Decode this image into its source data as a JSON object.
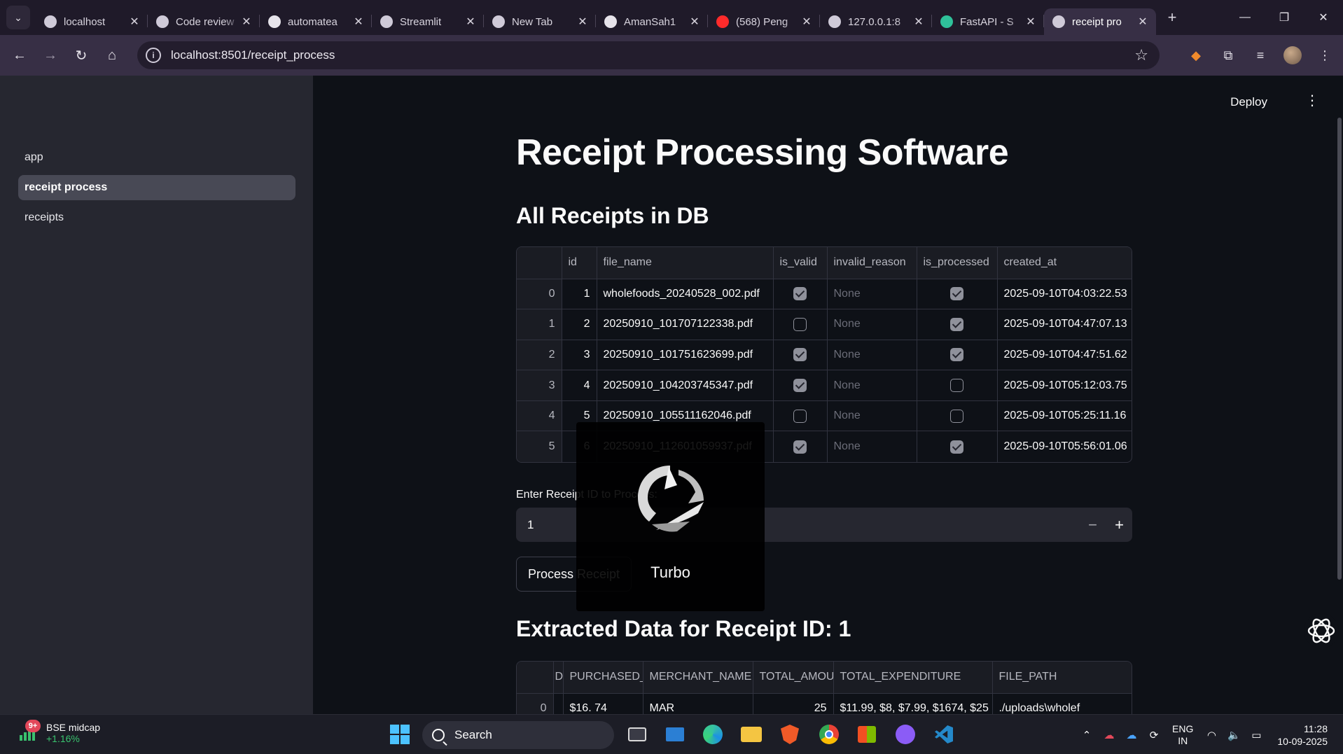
{
  "browser": {
    "tabs": [
      {
        "title": "localhost",
        "active": false
      },
      {
        "title": "Code review",
        "active": false
      },
      {
        "title": "automatea",
        "active": false
      },
      {
        "title": "Streamlit",
        "active": false
      },
      {
        "title": "New Tab",
        "active": false
      },
      {
        "title": "AmanSah1",
        "active": false
      },
      {
        "title": "(568) Peng",
        "active": false
      },
      {
        "title": "127.0.0.1:8",
        "active": false
      },
      {
        "title": "FastAPI - S",
        "active": false
      },
      {
        "title": "receipt pro",
        "active": true
      }
    ],
    "url": "localhost:8501/receipt_process"
  },
  "sidebar": {
    "items": [
      {
        "label": "app"
      },
      {
        "label": "receipt process"
      },
      {
        "label": "receipts"
      }
    ]
  },
  "header": {
    "deploy_label": "Deploy"
  },
  "page": {
    "title": "Receipt Processing Software",
    "receipts_heading": "All Receipts in DB",
    "input_label": "Enter Receipt ID to Process:",
    "input_value": "1",
    "process_button": "Process Receipt",
    "extracted_heading": "Extracted Data for Receipt ID: 1"
  },
  "receipts_table": {
    "columns": [
      "",
      "id",
      "file_name",
      "is_valid",
      "invalid_reason",
      "is_processed",
      "created_at"
    ],
    "rows": [
      {
        "index": "0",
        "id": "1",
        "file_name": "wholefoods_20240528_002.pdf",
        "is_valid": true,
        "invalid_reason": "None",
        "is_processed": true,
        "created_at": "2025-09-10T04:03:22.53"
      },
      {
        "index": "1",
        "id": "2",
        "file_name": "20250910_101707122338.pdf",
        "is_valid": false,
        "invalid_reason": "None",
        "is_processed": true,
        "created_at": "2025-09-10T04:47:07.13"
      },
      {
        "index": "2",
        "id": "3",
        "file_name": "20250910_101751623699.pdf",
        "is_valid": true,
        "invalid_reason": "None",
        "is_processed": true,
        "created_at": "2025-09-10T04:47:51.62"
      },
      {
        "index": "3",
        "id": "4",
        "file_name": "20250910_104203745347.pdf",
        "is_valid": true,
        "invalid_reason": "None",
        "is_processed": false,
        "created_at": "2025-09-10T05:12:03.75"
      },
      {
        "index": "4",
        "id": "5",
        "file_name": "20250910_105511162046.pdf",
        "is_valid": false,
        "invalid_reason": "None",
        "is_processed": false,
        "created_at": "2025-09-10T05:25:11.16"
      },
      {
        "index": "5",
        "id": "6",
        "file_name": "20250910_112601059937.pdf",
        "is_valid": true,
        "invalid_reason": "None",
        "is_processed": true,
        "created_at": "2025-09-10T05:56:01.06"
      }
    ]
  },
  "extracted_table": {
    "columns": [
      "",
      "D",
      "PURCHASED_AT",
      "MERCHANT_NAME",
      "TOTAL_AMOUNT",
      "TOTAL_EXPENDITURE",
      "FILE_PATH"
    ],
    "rows": [
      {
        "index": "0",
        "d": "",
        "purchased_at": "$16. 74",
        "merchant_name": "MAR",
        "total_amount": "25",
        "total_expenditure": "$11.99, $8, $7.99, $1674, $25",
        "file_path": "./uploads\\wholef"
      }
    ]
  },
  "overlay": {
    "label": "Turbo"
  },
  "taskbar": {
    "widget_badge": "9+",
    "widget_title": "BSE midcap",
    "widget_change": "+1.16%",
    "search_placeholder": "Search",
    "lang_line1": "ENG",
    "lang_line2": "IN",
    "time": "11:28",
    "date": "10-09-2025"
  }
}
